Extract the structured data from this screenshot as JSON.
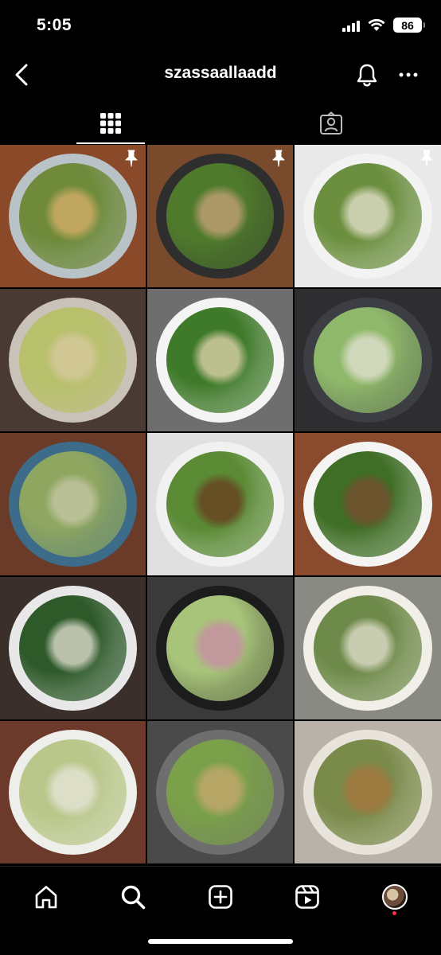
{
  "status_bar": {
    "time": "5:05",
    "battery": "86"
  },
  "header": {
    "username": "szassaallaadd"
  },
  "tabs": [
    {
      "icon": "grid-icon",
      "active": true
    },
    {
      "icon": "tagged-icon",
      "active": false
    }
  ],
  "posts": [
    {
      "pinned": true,
      "bg": "#8a4a2a",
      "plate": "#b9c2c6",
      "greens": "#6e8a3a",
      "cheese": "#d8b06a"
    },
    {
      "pinned": true,
      "bg": "#7a4a2c",
      "plate": "#2e2e2e",
      "greens": "#4f7a2c",
      "cheese": "#c9a27a"
    },
    {
      "pinned": true,
      "bg": "#e9e9e9",
      "plate": "#f3f3f3",
      "greens": "#6b8f3f",
      "cheese": "#e8e3d0"
    },
    {
      "pinned": false,
      "bg": "#4a3a34",
      "plate": "#c9c2b8",
      "greens": "#b7c06a",
      "cheese": "#d8c9a0"
    },
    {
      "pinned": false,
      "bg": "#6e6e6e",
      "plate": "#f4f4f4",
      "greens": "#3f7a2a",
      "cheese": "#e6d6b0"
    },
    {
      "pinned": false,
      "bg": "#2e2e30",
      "plate": "#3c3e44",
      "greens": "#8fb86a",
      "cheese": "#e6e2d6"
    },
    {
      "pinned": false,
      "bg": "#6b3b2a",
      "plate": "#3d6b8a",
      "greens": "#8ea660",
      "cheese": "#c8c8a8"
    },
    {
      "pinned": false,
      "bg": "#e0e0e0",
      "plate": "#f1f1f1",
      "greens": "#5a8a34",
      "cheese": "#6a3a20"
    },
    {
      "pinned": false,
      "bg": "#8a4a2e",
      "plate": "#f4f4f2",
      "greens": "#3f6e26",
      "cheese": "#7a4a30"
    },
    {
      "pinned": false,
      "bg": "#3a2f2a",
      "plate": "#e8e8e8",
      "greens": "#2e5a2a",
      "cheese": "#e8e3d6"
    },
    {
      "pinned": false,
      "bg": "#3a3a3a",
      "plate": "#1c1c1c",
      "greens": "#a8c47a",
      "cheese": "#c98aa6"
    },
    {
      "pinned": false,
      "bg": "#8a8a84",
      "plate": "#f1efe8",
      "greens": "#6e8a4a",
      "cheese": "#e6e2d2"
    },
    {
      "pinned": false,
      "bg": "#6b3a2a",
      "plate": "#eeeeea",
      "greens": "#b9c78a",
      "cheese": "#e8e6dc"
    },
    {
      "pinned": false,
      "bg": "#4a4a4a",
      "plate": "#6e6e6e",
      "greens": "#7aa04a",
      "cheese": "#c9a870"
    },
    {
      "pinned": false,
      "bg": "#b9b2a8",
      "plate": "#e8e4dc",
      "greens": "#7a8a4a",
      "cheese": "#a8743c"
    }
  ],
  "nav": [
    {
      "icon": "home-icon"
    },
    {
      "icon": "search-icon",
      "active": true
    },
    {
      "icon": "create-icon"
    },
    {
      "icon": "reels-icon"
    },
    {
      "icon": "profile-avatar"
    }
  ]
}
